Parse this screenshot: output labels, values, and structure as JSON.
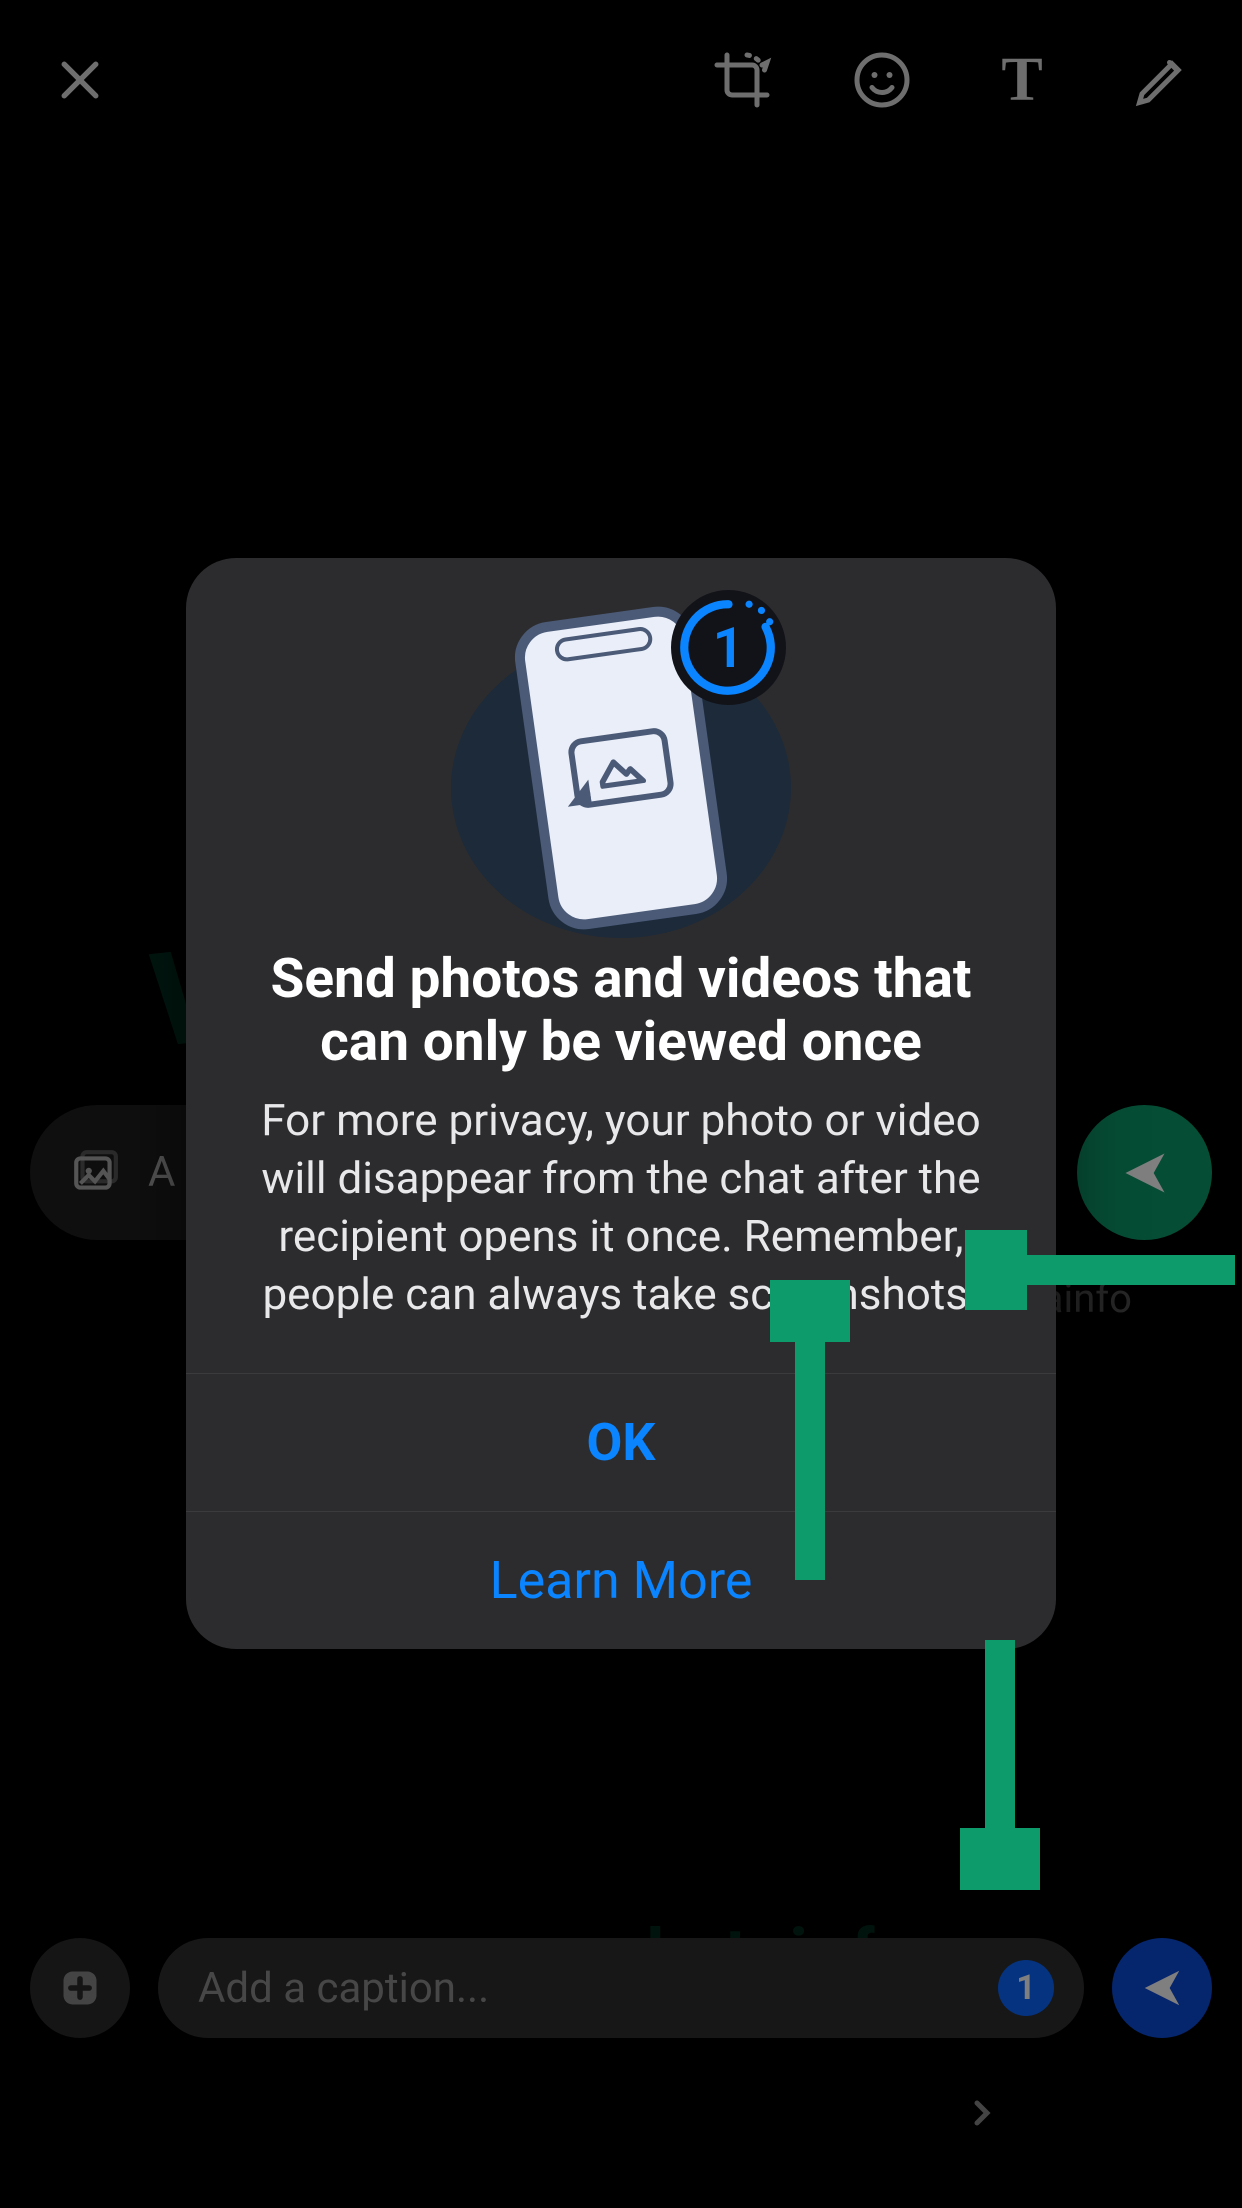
{
  "toolbar": {
    "close": "Close",
    "crop": "Crop & Rotate",
    "emoji": "Emoji / Sticker",
    "text": "T",
    "draw": "Draw"
  },
  "midRow": {
    "placeholder": "A",
    "send": "Send"
  },
  "bottomRow": {
    "add": "+",
    "placeholder": "Add a caption...",
    "viewOnceBadge": "1",
    "send": "Send"
  },
  "modal": {
    "title": "Send photos and videos that can only be viewed once",
    "body": "For more privacy, your photo or video will disappear from the chat after the recipient opens it once. Remember, people can always take screenshots.",
    "ok": "OK",
    "learnMore": "Learn More",
    "badgeOne": "1"
  },
  "watermark": {
    "big": "WABETAINFO",
    "small": "wabetainfo",
    "peek": "etainfo"
  }
}
